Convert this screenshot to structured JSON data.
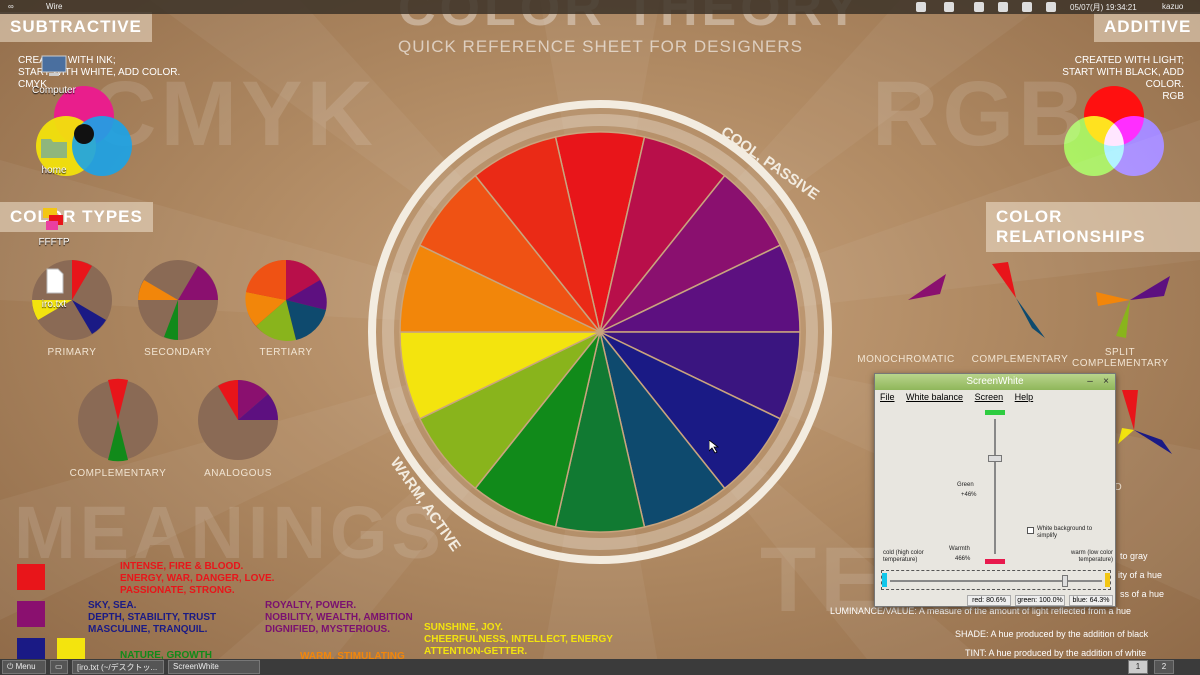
{
  "wallpaper": {
    "title_top": "COLOR THEORY",
    "subtitle": "QUICK REFERENCE SHEET FOR DESIGNERS",
    "subtractive": {
      "tag": "SUBTRACTIVE",
      "note_lines": [
        "CREATED WITH INK;",
        "START WITH WHITE, ADD COLOR.",
        "CMYK"
      ],
      "ghost": "CMYK"
    },
    "additive": {
      "tag": "ADDITIVE",
      "note_lines": [
        "CREATED WITH LIGHT;",
        "START WITH BLACK, ADD COLOR.",
        "RGB"
      ],
      "ghost": "RGB"
    },
    "color_types": {
      "tag": "COLOR TYPES",
      "captions": [
        "PRIMARY",
        "SECONDARY",
        "TERTIARY",
        "COMPLEMENTARY",
        "ANALOGOUS"
      ]
    },
    "color_relationships": {
      "tag": "COLOR RELATIONSHIPS",
      "captions": [
        "MONOCHROMATIC",
        "COMPLEMENTARY",
        "SPLIT COMPLEMENTARY",
        "TRIAD"
      ]
    },
    "wheel": {
      "cool_label": "COOL, PASSIVE",
      "warm_label": "WARM, ACTIVE",
      "colors": [
        "#e8151a",
        "#b80f4a",
        "#8a106f",
        "#5d1080",
        "#3a1580",
        "#1a1a85",
        "#0e4a6e",
        "#117a32",
        "#118a1a",
        "#89b41c",
        "#f3e40e",
        "#f2860a",
        "#ef5214",
        "#ea2a16"
      ]
    },
    "meanings": {
      "ghost": "MEANINGS",
      "items": [
        {
          "color": "#e8151a",
          "text_color": "#e8151a",
          "lines": [
            "INTENSE, FIRE & BLOOD.",
            "ENERGY, WAR, DANGER, LOVE.",
            "PASSIONATE, STRONG."
          ]
        },
        {
          "color": "#8a106f",
          "text_color": "#7a1070",
          "lines": [
            "ROYALTY, POWER.",
            "NOBILITY, WEALTH, AMBITION",
            "DIGNIFIED, MYSTERIOUS."
          ]
        },
        {
          "color": "#1a1a85",
          "text_color": "#1a1a85",
          "lines": [
            "SKY, SEA.",
            "DEPTH, STABILITY, TRUST",
            "MASCULINE, TRANQUIL."
          ]
        },
        {
          "color": "#f3e40e",
          "text_color": "#f3e40e",
          "lines": [
            "SUNSHINE, JOY.",
            "CHEERFULNESS, INTELLECT, ENERGY",
            "ATTENTION-GETTER."
          ]
        },
        {
          "color": "#118a1a",
          "text_color": "#118a1a",
          "lines": [
            "NATURE, GROWTH"
          ]
        },
        {
          "color": "#f2860a",
          "text_color": "#f2860a",
          "lines": [
            "WARM, STIMULATING"
          ]
        }
      ]
    },
    "terms": {
      "ghost": "TERMS",
      "lines": [
        "to gray",
        "ity of a hue",
        "ss of a hue",
        "LUMINANCE/VALUE: A measure of the amount of light reflected from a hue",
        "SHADE: A hue produced by the addition of black",
        "TINT: A hue produced by the addition of white"
      ]
    }
  },
  "top_panel": {
    "left_label": "∞",
    "window_label": "Wire",
    "clock": "05/07(月) 19:34:21",
    "user": "kazuo"
  },
  "desktop_icons": [
    {
      "label": "Computer",
      "icon": "computer-icon"
    },
    {
      "label": "home",
      "icon": "folder-icon"
    },
    {
      "label": "FFFTP",
      "icon": "ffftp-icon"
    },
    {
      "label": "iro.txt",
      "icon": "text-file-icon"
    }
  ],
  "taskbar": {
    "menu_label": "Menu",
    "tasks": [
      "[iro.txt (~/デスクトッ...",
      "ScreenWhite"
    ],
    "workspaces": [
      "1",
      "2"
    ]
  },
  "screenwhite": {
    "title": "ScreenWhite",
    "menu": [
      "File",
      "White balance",
      "Screen",
      "Help"
    ],
    "green_label": "Green",
    "green_pct": "+46%",
    "checkbox_label": "White background to simplify",
    "warmth_label": "Warmth",
    "warmth_value": "466%",
    "cold_label": "cold (high color temperature)",
    "warm_label": "warm (low color temperature)",
    "status": {
      "red": "red: 80.6%",
      "green": "green: 100.0%",
      "blue": "blue: 64.3%"
    },
    "accent": "#2ecc40"
  }
}
